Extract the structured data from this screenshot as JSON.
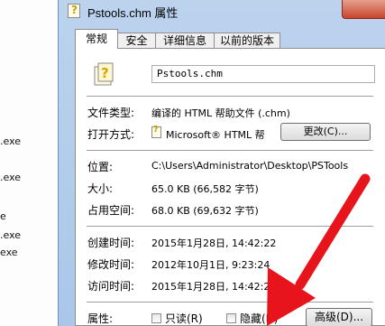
{
  "background": {
    "files": [
      ".exe",
      "",
      ".exe",
      "e",
      ".exe",
      "exe"
    ]
  },
  "dialog": {
    "title": "Pstools.chm 属性",
    "tabs": [
      "常规",
      "安全",
      "详细信息",
      "以前的版本"
    ],
    "active_tab": "常规",
    "file_name": "Pstools.chm",
    "props": {
      "type_label": "文件类型:",
      "type_value": "编译的 HTML 帮助文件 (.chm)",
      "openwith_label": "打开方式:",
      "openwith_value": "Microsoft® HTML 帮",
      "change_button": "更改(C)...",
      "location_label": "位置:",
      "location_value": "C:\\Users\\Administrator\\Desktop\\PSTools",
      "size_label": "大小:",
      "size_value": "65.0 KB (66,582 字节)",
      "disk_label": "占用空间:",
      "disk_value": "68.0 KB (69,632 字节)",
      "created_label": "创建时间:",
      "created_value": "2015年1月28日, 14:42:22",
      "modified_label": "修改时间:",
      "modified_value": "2012年10月1日, 9:23:24",
      "accessed_label": "访问时间:",
      "accessed_value": "2015年1月28日, 14:42:22",
      "attributes_label": "属性:",
      "readonly_label": "只读(R)",
      "hidden_label": "隐藏(H)",
      "advanced_button": "高级(D)..."
    }
  },
  "colors": {
    "annotation_arrow": "#e8141b",
    "frame": "#aac6e9",
    "close_button": "#c8452b"
  }
}
